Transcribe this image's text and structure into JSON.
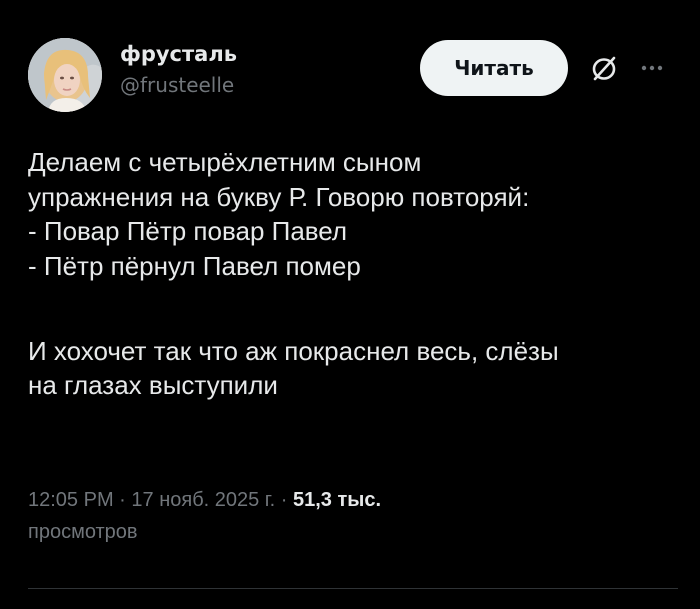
{
  "author": {
    "display_name": "фрусталь",
    "handle": "@frusteelle",
    "avatar_icon": "avatar"
  },
  "actions": {
    "follow_label": "Читать",
    "grok_icon": "grok-icon",
    "more_icon": "more-icon"
  },
  "tweet": {
    "lines": [
      "Делаем с четырёхлетним сыном",
      "упражнения на букву Р. Говорю повторяй:",
      "- Повар Пётр повар Павел",
      "- Пётр пёрнул Павел помер",
      "И хохочет так что аж покраснел весь, слёзы",
      "на глазах выступили"
    ]
  },
  "meta": {
    "time": "12:05 PM",
    "separator": " · ",
    "date": "17 нояб. 2025 г.",
    "views_count": "51,3 тыс.",
    "views_label": "просмотров"
  },
  "colors": {
    "background": "#000000",
    "text": "#e7e9ea",
    "secondary": "#71767b",
    "button_bg": "#eff3f4",
    "divider": "#2f3336"
  }
}
